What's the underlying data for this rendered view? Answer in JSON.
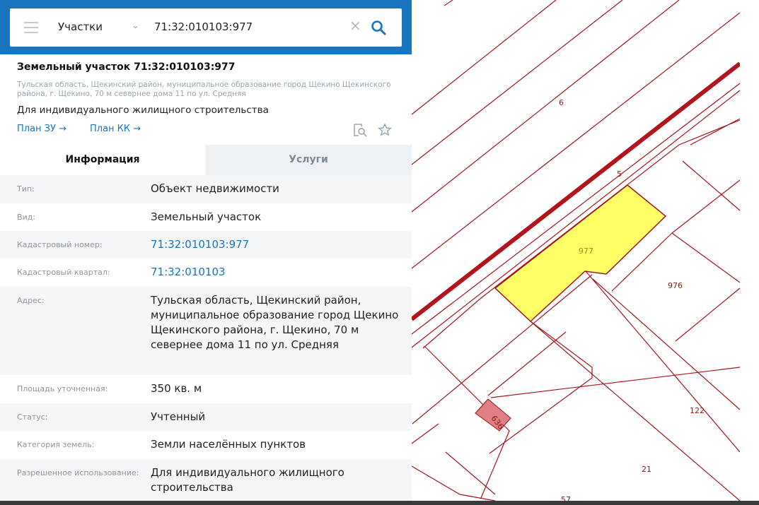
{
  "search": {
    "type_label": "Участки",
    "query": "71:32:010103:977"
  },
  "object": {
    "title": "Земельный участок 71:32:010103:977",
    "address_short": "Тульская область, Щекинский район, муниципальное образование город Щекино Щекинского района, г. Щекино, 70 м севернее дома 11 по ул. Средняя",
    "purpose": "Для индивидуального жилищного строительства",
    "links": [
      "План ЗУ →",
      "План КК →"
    ]
  },
  "tabs": [
    {
      "label": "Информация",
      "active": true
    },
    {
      "label": "Услуги",
      "active": false
    }
  ],
  "rows": [
    {
      "label": "Тип:",
      "value": "Объект недвижимости",
      "link": false
    },
    {
      "label": "Вид:",
      "value": "Земельный участок",
      "link": false
    },
    {
      "label": "Кадастровый номер:",
      "value": "71:32:010103:977",
      "link": true
    },
    {
      "label": "Кадастровый квартал:",
      "value": "71:32:010103",
      "link": true
    },
    {
      "label": "Адрес:",
      "value": "Тульская область, Щекинский район, муниципальное образование город Щекино Щекинского района, г. Щекино, 70 м севернее дома 11 по ул. Средняя",
      "link": false
    },
    {
      "label": "Площадь уточненная:",
      "value": "350 кв. м",
      "link": false
    },
    {
      "label": "Статус:",
      "value": "Учтенный",
      "link": false
    },
    {
      "label": "Категория земель:",
      "value": "Земли населённых пунктов",
      "link": false
    },
    {
      "label": "Разрешенное использование:",
      "value": "Для индивидуального жилищного строительства",
      "link": false
    }
  ],
  "map": {
    "labels": [
      "6",
      "5",
      "977",
      "976",
      "122",
      "636",
      "21",
      "57"
    ],
    "colors": {
      "boundary": "#a4141c",
      "selected_fill": "#ffff66",
      "building_fill": "#e07f86",
      "header_blue": "#1a74c0"
    }
  },
  "icons": [
    "menu-icon",
    "chevron-down-icon",
    "close-icon",
    "search-icon",
    "collapse-panel-icon",
    "document-search-icon",
    "star-icon"
  ]
}
